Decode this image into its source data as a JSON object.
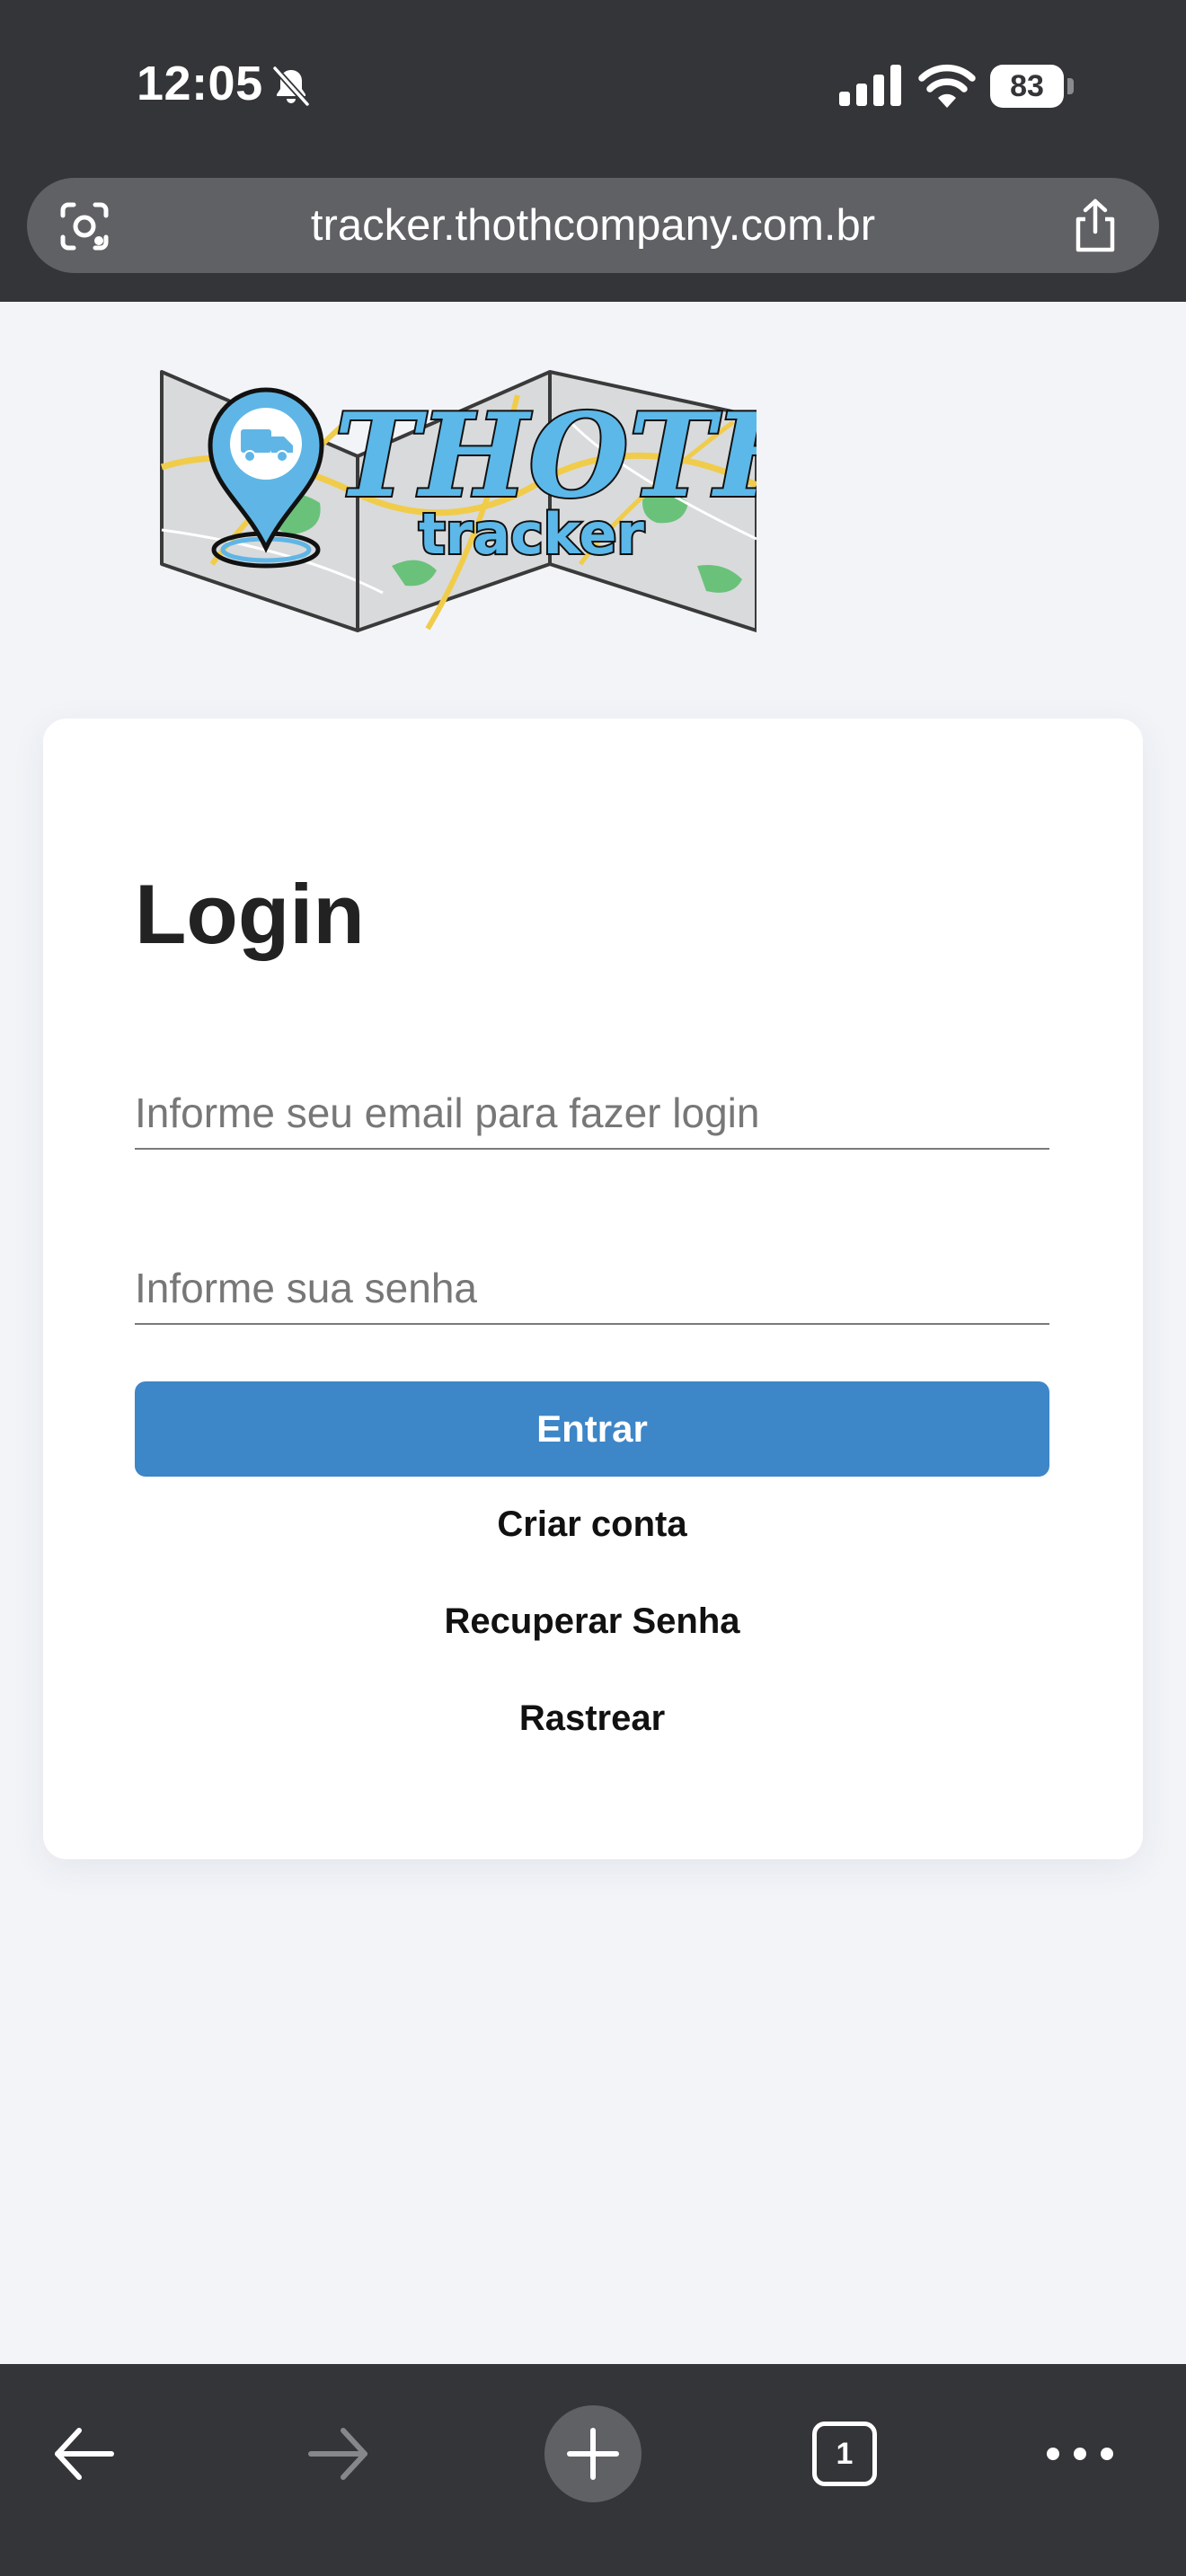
{
  "status_bar": {
    "time": "12:05",
    "battery_level": "83",
    "icons": [
      "bell-slash-icon",
      "cellular-signal-icon",
      "wifi-icon",
      "battery-icon"
    ]
  },
  "browser": {
    "url": "tracker.thothcompany.com.br",
    "icons": [
      "lens-icon",
      "share-icon"
    ]
  },
  "logo": {
    "brand": "THOTH",
    "subtitle": "tracker",
    "colors": {
      "pin": "#5fb6e6",
      "title": "#5cb8e8",
      "map_road": "#f0cc4a",
      "map_green": "#6ac27a",
      "map_base": "#d9dadc"
    }
  },
  "login": {
    "title": "Login",
    "email_placeholder": "Informe seu email para fazer login",
    "email_value": "",
    "password_placeholder": "Informe sua senha",
    "password_value": "",
    "submit_label": "Entrar",
    "links": {
      "create_account": "Criar conta",
      "recover_password": "Recuperar Senha",
      "track": "Rastrear"
    }
  },
  "toolbar": {
    "tabs_count": "1",
    "icons": [
      "back-arrow-icon",
      "forward-arrow-icon",
      "plus-icon",
      "tabs-icon",
      "more-icon"
    ]
  },
  "colors": {
    "chrome_background": "#343538",
    "address_bar": "#5f6165",
    "page_background": "#f2f4f8",
    "card_background": "#ffffff",
    "primary_button": "#3d86c8",
    "title_text": "#222222"
  }
}
